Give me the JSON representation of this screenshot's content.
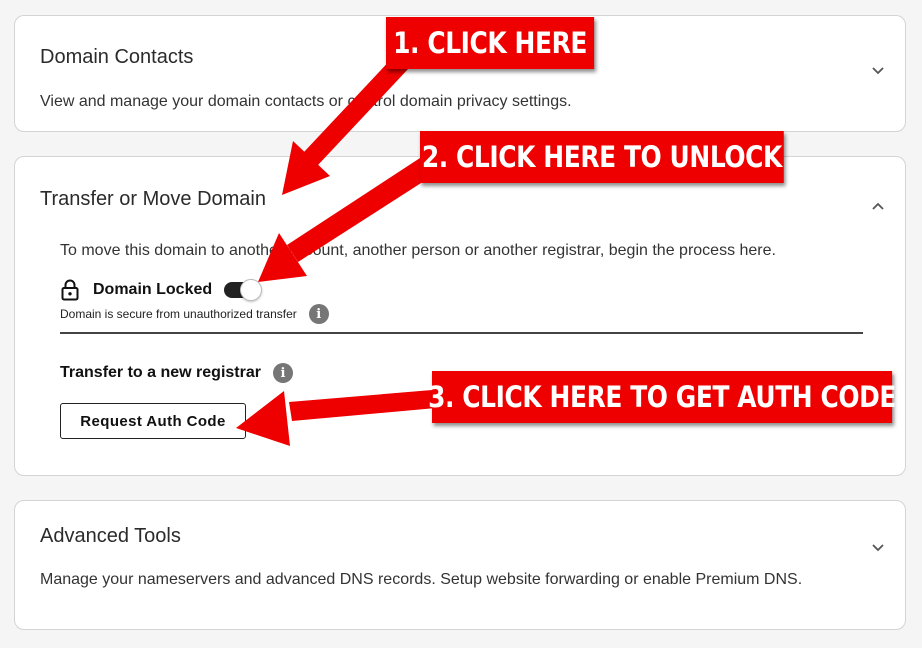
{
  "sections": {
    "contacts": {
      "title": "Domain Contacts",
      "description": "View and manage your domain contacts or control domain privacy settings."
    },
    "transfer": {
      "title": "Transfer or Move Domain",
      "description": "To move this domain to another account, another person or another registrar, begin the process here.",
      "lock_label": "Domain Locked",
      "lock_subtext": "Domain is secure from unauthorized transfer",
      "lock_enabled": true,
      "registrar_label": "Transfer to a new registrar",
      "button_label": "Request Auth Code"
    },
    "advanced": {
      "title": "Advanced Tools",
      "description": "Manage your nameservers and advanced DNS records. Setup website forwarding or enable Premium DNS."
    }
  },
  "icons": {
    "lock": "lock-icon",
    "info": "info-icon",
    "chevron_down": "chevron-down-icon",
    "chevron_up": "chevron-up-icon"
  },
  "annotations": {
    "step1": "1. CLICK HERE",
    "step2": "2. CLICK HERE TO UNLOCK",
    "step3": "3. CLICK HERE TO GET AUTH CODE",
    "color": "#e00000"
  }
}
